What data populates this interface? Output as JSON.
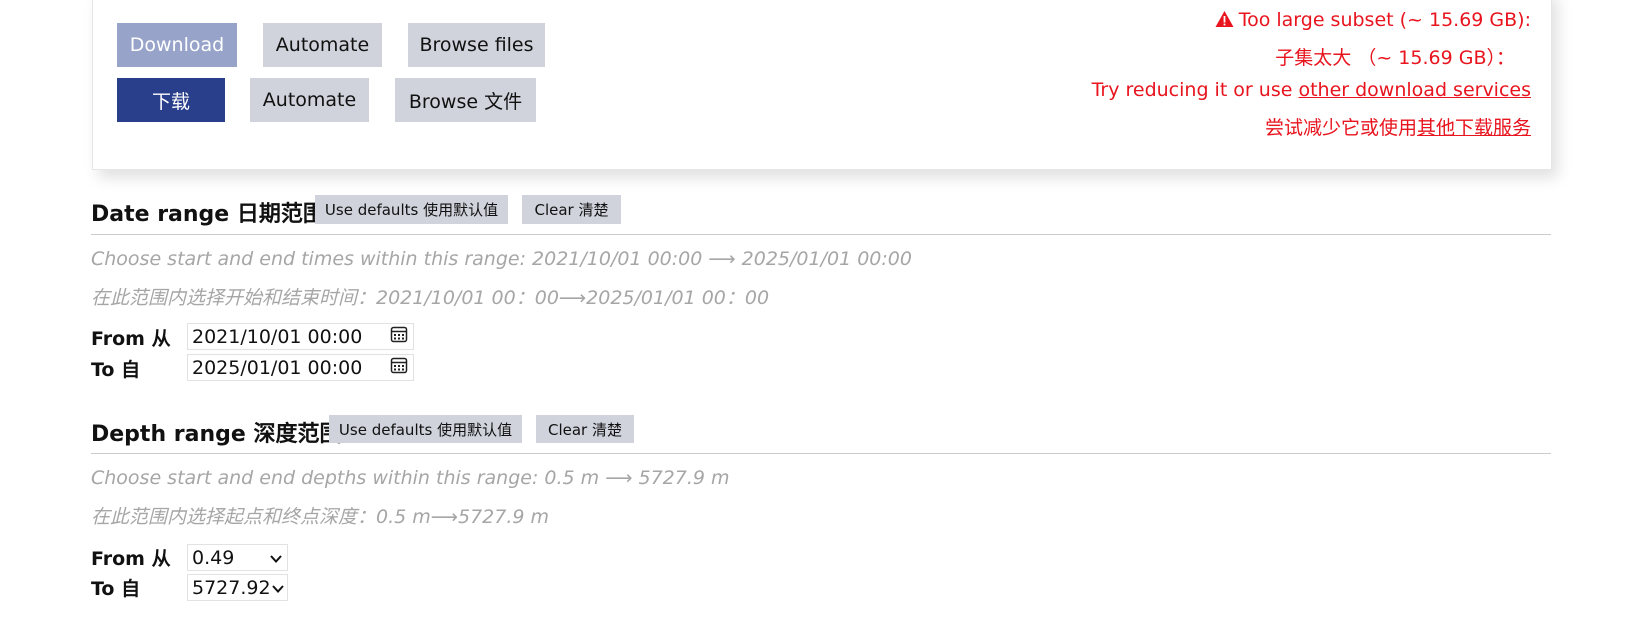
{
  "actions": {
    "download_en": "Download",
    "download_zh": "下载",
    "automate_en": "Automate",
    "automate_zh": "Automate",
    "browse_en": "Browse files",
    "browse_zh": "Browse 文件"
  },
  "warning": {
    "line1": "Too large subset (~ 15.69 GB):",
    "line2": "子集太大 （~ 15.69 GB）：",
    "line3_prefix": "Try reducing it or use ",
    "line3_link": "other download services",
    "line4_prefix": "尝试减少它或使用",
    "line4_link": "其他下载服务",
    "color": "#e8141e"
  },
  "date_range": {
    "title": "Date range 日期范围",
    "use_defaults": "Use defaults 使用默认值",
    "clear": "Clear 清楚",
    "hint_en": "Choose start and end times within this range:  2021/10/01 00:00  ⟶  2025/01/01 00:00",
    "hint_zh": "在此范围内选择开始和结束时间：2021/10/01 00：00⟶2025/01/01 00：00",
    "from_label": "From 从",
    "to_label": "To 自",
    "from_value": "2021/10/01 00:00",
    "to_value": "2025/01/01 00:00"
  },
  "depth_range": {
    "title": "Depth range 深度范围",
    "use_defaults": "Use defaults 使用默认值",
    "clear": "Clear 清楚",
    "hint_en": "Choose start and end depths within this range:  0.5 m  ⟶  5727.9 m",
    "hint_zh": "在此范围内选择起点和终点深度：0.5 m⟶5727.9 m",
    "from_label": "From 从",
    "to_label": "To 自",
    "from_value": "0.49",
    "to_value": "5727.92"
  },
  "colors": {
    "primary": "#2a3f8c",
    "primary_disabled": "#97a3c9",
    "secondary_button": "#d0d3dc",
    "hint_text": "#a6a6a6"
  }
}
